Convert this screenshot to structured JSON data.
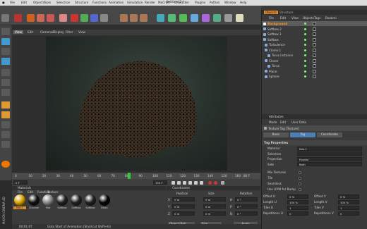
{
  "window": {
    "title": "Untitled 2 *"
  },
  "menu": [
    "File",
    "Edit",
    "Objects",
    "Tools",
    "Selection",
    "Structure",
    "Functions",
    "Animation",
    "Simulation",
    "Render",
    "MoCraft",
    "Character",
    "Plugins",
    "Python",
    "Window",
    "Help"
  ],
  "right_tabs": [
    "Objects",
    "Structure"
  ],
  "obj_menu": [
    "File",
    "Edit",
    "View",
    "Objects",
    "Tags",
    "Bookmi"
  ],
  "objects": [
    {
      "name": "Background",
      "sel": true
    },
    {
      "name": "Softbox.2"
    },
    {
      "name": "Softbox.1"
    },
    {
      "name": "Softbox"
    },
    {
      "name": "Turbulence"
    },
    {
      "name": "Cloner.1"
    },
    {
      "name": "Torus instance"
    },
    {
      "name": "Cloner"
    },
    {
      "name": "Torus"
    },
    {
      "name": "Plane"
    },
    {
      "name": "Sphere"
    }
  ],
  "attributes": {
    "title": "Attributes",
    "menu": [
      "Mode",
      "Edit",
      "User Data"
    ],
    "header": "Texture Tag [Texture]",
    "tabs": [
      "Basic",
      "Tag",
      "Coordinates"
    ],
    "section": "Tag Properties",
    "rows": [
      {
        "label": "Material",
        "value": "Mat.1"
      },
      {
        "label": "Selection",
        "value": ""
      },
      {
        "label": "Projection",
        "value": "Frontal"
      },
      {
        "label": "Side",
        "value": "Both"
      }
    ],
    "checks": [
      "Mix Textures",
      "Tile",
      "Seamless",
      "Use UVW for Bump"
    ],
    "grid": [
      {
        "l": "Offset U",
        "v": "0 %",
        "l2": "Offset V",
        "v2": "0 %"
      },
      {
        "l": "Length U",
        "v": "100 %",
        "l2": "Length V",
        "v2": "100 %"
      },
      {
        "l": "Tiles U",
        "v": "1",
        "l2": "Tiles V",
        "v2": "1"
      },
      {
        "l": "Repetitions U",
        "v": "0",
        "l2": "Repetitions V",
        "v2": "0"
      }
    ]
  },
  "viewport": {
    "label": "View",
    "menu": [
      "Edit",
      "Cameras",
      "Display",
      "Filter",
      "View"
    ]
  },
  "timeline": {
    "ticks": [
      "0",
      "10",
      "20",
      "30",
      "40",
      "50",
      "60",
      "70",
      "80",
      "90",
      "100",
      "110",
      "120",
      "130",
      "140",
      "150",
      "160"
    ],
    "start": "0 F",
    "end": "80 F",
    "current": "155 F",
    "cursor_value": 50
  },
  "materials": {
    "title": "Materials",
    "menu": [
      "File",
      "Edit",
      "Function",
      "Texture"
    ],
    "items": [
      {
        "name": "Mat.1",
        "color": "#d9a300"
      },
      {
        "name": "Channel",
        "color": "#111"
      },
      {
        "name": "Mat",
        "color": "#8a8a8a"
      },
      {
        "name": "Softbox",
        "color": "#222"
      },
      {
        "name": "Softbox",
        "color": "#222"
      },
      {
        "name": "Softbox",
        "color": "#222"
      },
      {
        "name": "Black",
        "color": "#050505"
      }
    ]
  },
  "coordinates": {
    "title": "Coordinates",
    "cols": [
      "Position",
      "Size",
      "Rotation"
    ],
    "rows": [
      {
        "axis": "X",
        "p": "0 m",
        "s": "0 m",
        "r": "0 °",
        "rl": "H"
      },
      {
        "axis": "Y",
        "p": "0 m",
        "s": "0 m",
        "r": "0 °",
        "rl": "P"
      },
      {
        "axis": "Z",
        "p": "0 m",
        "s": "0 m",
        "r": "0 °",
        "rl": "B"
      }
    ],
    "mode": "Object (Rel)",
    "size_mode": "Size",
    "apply": "Apply"
  },
  "status": {
    "time": "00:01:07",
    "text": "Goto Start of Animation [Shortcut Shift+G]"
  },
  "brand": "MAXON CINEMA 4D"
}
